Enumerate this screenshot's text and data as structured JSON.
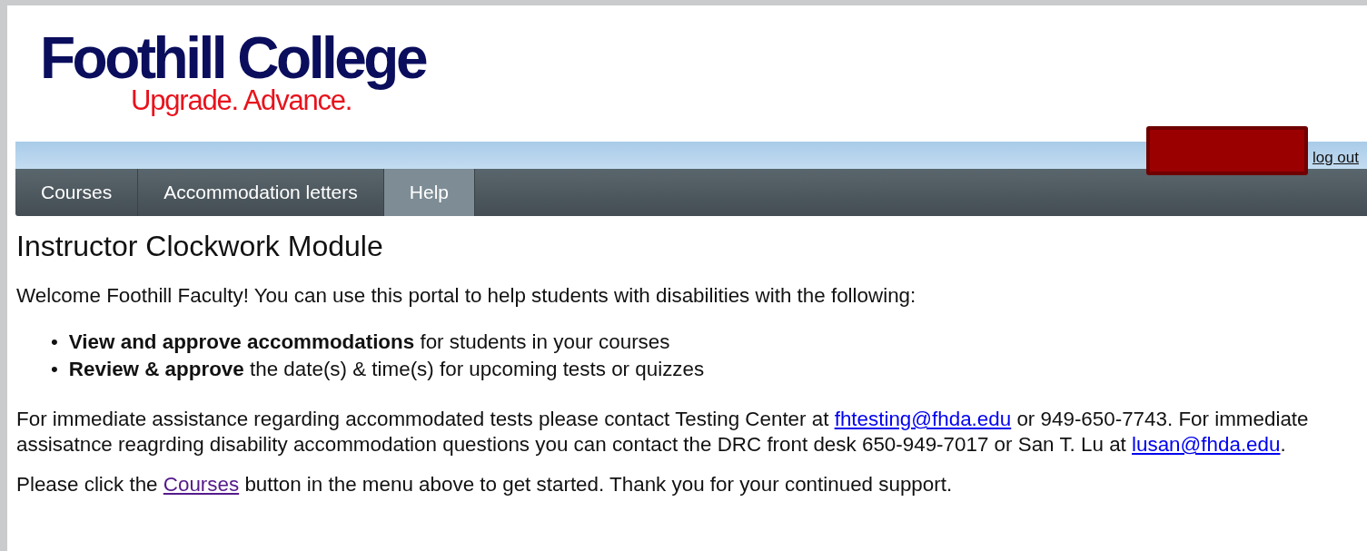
{
  "logo": {
    "name": "Foothill College",
    "tagline": "Upgrade. Advance."
  },
  "user_bar": {
    "logout": "log out"
  },
  "nav": [
    {
      "label": "Courses",
      "selected": false
    },
    {
      "label": "Accommodation letters",
      "selected": false
    },
    {
      "label": "Help",
      "selected": true
    }
  ],
  "title": "Instructor Clockwork Module",
  "intro": "Welcome Foothill Faculty! You can use this portal to help students with disabilities with the following:",
  "bullets": [
    {
      "marker": "•",
      "text": "**View and approve accommodations** for students in your courses"
    },
    {
      "marker": "•",
      "text": "**Review & approve** the date(s) & time(s) for upcoming tests or quizzes"
    }
  ],
  "paragraphs": [
    [
      {
        "kind": "text",
        "text": "For immediate assistance regarding accommodated tests please contact Testing Center at "
      },
      {
        "kind": "link",
        "text": "fhtesting@fhda.edu",
        "visited": false
      },
      {
        "kind": "text",
        "text": " or 949-650-7743. For immediate assisatnce reagrding disability accommodation questions you can contact the DRC front desk 650-949-7017 or San T. Lu at "
      },
      {
        "kind": "link",
        "text": "lusan@fhda.edu",
        "visited": false
      },
      {
        "kind": "text",
        "text": "."
      }
    ],
    [
      {
        "kind": "text",
        "text": "Please click the "
      },
      {
        "kind": "link",
        "text": "Courses",
        "visited": true
      },
      {
        "kind": "text",
        "text": " button in the menu above to get started. Thank you for your continued support."
      }
    ]
  ]
}
